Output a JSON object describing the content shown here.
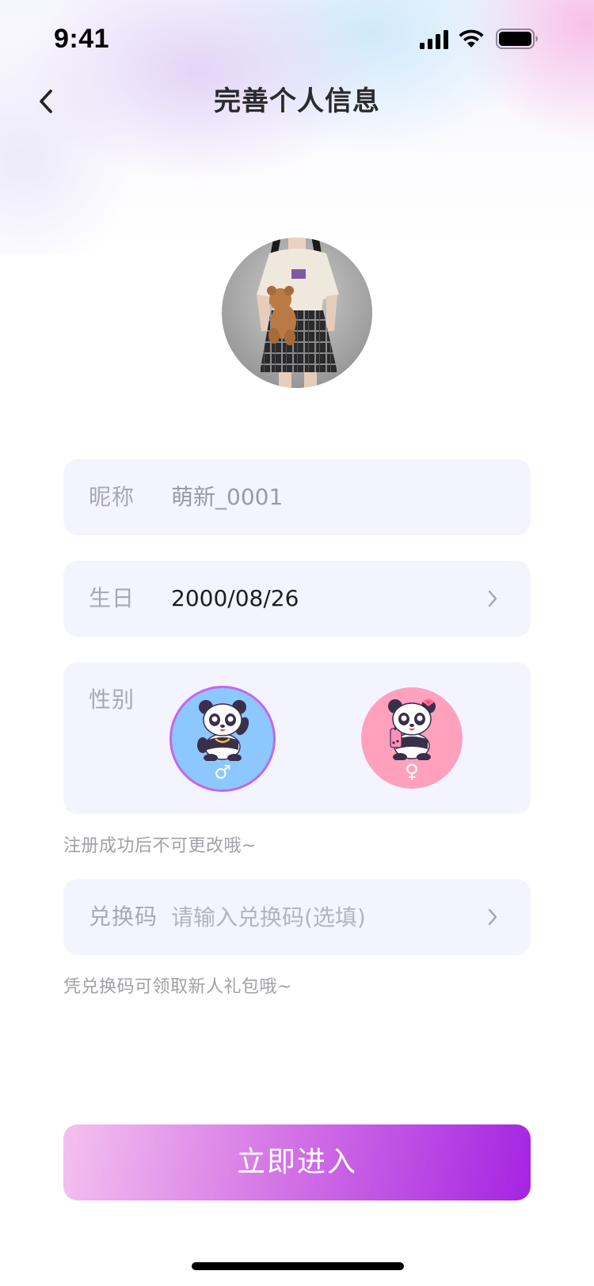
{
  "status_bar": {
    "time": "9:41"
  },
  "header": {
    "title": "完善个人信息",
    "back_icon": "chevron-left-icon"
  },
  "profile": {
    "avatar_alt": "avatar"
  },
  "form": {
    "nickname": {
      "label": "昵称",
      "value": "萌新_0001"
    },
    "birthday": {
      "label": "生日",
      "value": "2000/08/26"
    },
    "gender": {
      "label": "性别",
      "male_symbol": "♂",
      "female_symbol": "♀",
      "selected": "male",
      "hint": "注册成功后不可更改哦~"
    },
    "redeem_code": {
      "label": "兑换码",
      "placeholder": "请输入兑换码(选填)",
      "value": "",
      "hint": "凭兑换码可领取新人礼包哦~"
    }
  },
  "actions": {
    "enter_label": "立即进入"
  },
  "colors": {
    "field_bg": "#f3f4fe",
    "male_bg": "#8cc8ff",
    "female_bg": "#ffa1bd",
    "button_gradient_start": "#f4c1ef",
    "button_gradient_end": "#a524e2",
    "selected_ring": "#c466ee"
  }
}
